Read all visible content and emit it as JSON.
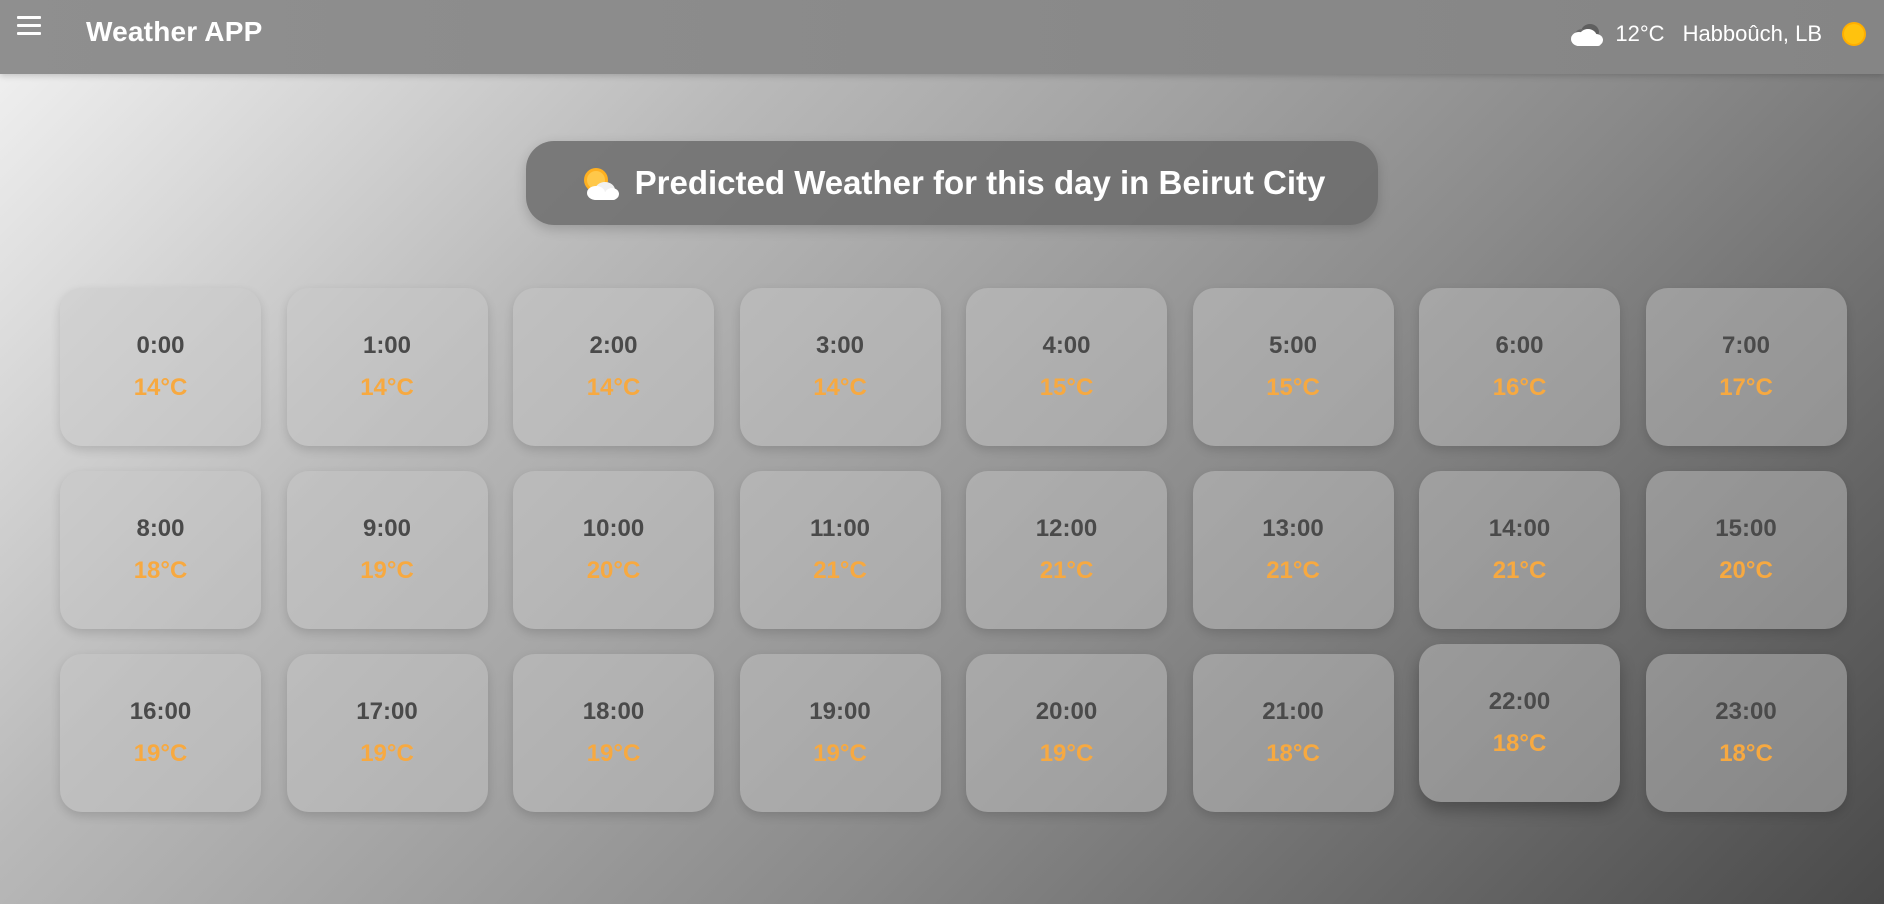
{
  "header": {
    "app_title": "Weather APP",
    "current_temp": "12°C",
    "location": "Habboûch, LB",
    "icons": {
      "menu": "menu-icon",
      "weather": "cloud-icon",
      "theme": "sun-icon"
    }
  },
  "banner": {
    "title": "Predicted Weather for this day in Beirut City",
    "icon": "sun-behind-cloud-icon"
  },
  "hourly": [
    {
      "time": "0:00",
      "temp": "14°C"
    },
    {
      "time": "1:00",
      "temp": "14°C"
    },
    {
      "time": "2:00",
      "temp": "14°C"
    },
    {
      "time": "3:00",
      "temp": "14°C"
    },
    {
      "time": "4:00",
      "temp": "15°C"
    },
    {
      "time": "5:00",
      "temp": "15°C"
    },
    {
      "time": "6:00",
      "temp": "16°C"
    },
    {
      "time": "7:00",
      "temp": "17°C"
    },
    {
      "time": "8:00",
      "temp": "18°C"
    },
    {
      "time": "9:00",
      "temp": "19°C"
    },
    {
      "time": "10:00",
      "temp": "20°C"
    },
    {
      "time": "11:00",
      "temp": "21°C"
    },
    {
      "time": "12:00",
      "temp": "21°C"
    },
    {
      "time": "13:00",
      "temp": "21°C"
    },
    {
      "time": "14:00",
      "temp": "21°C"
    },
    {
      "time": "15:00",
      "temp": "20°C"
    },
    {
      "time": "16:00",
      "temp": "19°C"
    },
    {
      "time": "17:00",
      "temp": "19°C"
    },
    {
      "time": "18:00",
      "temp": "19°C"
    },
    {
      "time": "19:00",
      "temp": "19°C"
    },
    {
      "time": "20:00",
      "temp": "19°C"
    },
    {
      "time": "21:00",
      "temp": "18°C"
    },
    {
      "time": "22:00",
      "temp": "18°C"
    },
    {
      "time": "23:00",
      "temp": "18°C"
    }
  ],
  "colors": {
    "temperature": "#f7a940",
    "time_text": "#4a4a4a",
    "sun": "#ffc20e"
  }
}
